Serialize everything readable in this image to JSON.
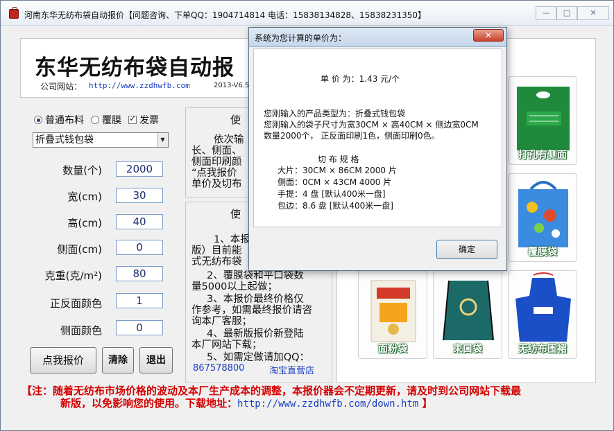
{
  "window": {
    "title": "河南东华无纺布袋自动报价【问题咨询、下单QQ：1904714814  电话：15838134828、15838231350】",
    "minimize": "—",
    "maximize": "□",
    "close": "✕"
  },
  "banner": {
    "title": "东华无纺布袋自动报",
    "site_label": "公司网站：",
    "site_url": "http://www.zzdhwfb.com",
    "version": "2013-V6.5"
  },
  "options": {
    "radio1": "普通布料",
    "radio2": "覆膜",
    "check": "发票",
    "radio1_selected": true,
    "check_checked": true
  },
  "product_select": {
    "value": "折叠式钱包袋"
  },
  "fields": [
    {
      "label": "数量(个)",
      "value": "2000"
    },
    {
      "label": "宽(cm)",
      "value": "30"
    },
    {
      "label": "高(cm)",
      "value": "40"
    },
    {
      "label": "侧面(cm)",
      "value": "0"
    },
    {
      "label": "克重(克/m²)",
      "value": "80"
    },
    {
      "label": "正反面颜色",
      "value": "1"
    },
    {
      "label": "侧面颜色",
      "value": "0"
    }
  ],
  "buttons": {
    "quote": "点我报价",
    "clear": "清除",
    "exit": "退出"
  },
  "panel1": {
    "heading": "使",
    "lines": [
      "依次输",
      "长、侧面、",
      "侧面印刷颜",
      "“点我报价",
      "单价及切布"
    ]
  },
  "panel2": {
    "heading": "使",
    "lines": [
      "1、本报",
      "版）目前能",
      "式无纺布袋",
      "2、覆膜袋和平口袋数",
      "量5000以上起做；",
      "3、本报价最终价格仅",
      "作参考，如需最终报价请咨",
      "询本厂客服；",
      "4、最新版报价新登陆",
      "本厂网站下载；",
      "5、如需定做请加QQ："
    ],
    "qq": "867578800",
    "shop": "淘宝直营店"
  },
  "gallery": {
    "captions": [
      "打孔有侧面",
      "覆膜袋",
      "面粉袋",
      "束口袋",
      "无纺布围裙"
    ]
  },
  "note": {
    "text1": "【注：随着无纺布市场价格的波动及本厂生产成本的调整，本报价器会不定期更新，请及时到公司网站下载最",
    "text2": "新版，以免影响您的使用。下载地址：",
    "url": "http://www.zzdhwfb.com/down.htm",
    "end": "】"
  },
  "dialog": {
    "title": "系统为您计算的单价为：",
    "close": "✕",
    "price": "单 价 为：1.43 元/个",
    "type_line": "您刚输入的产品类型为：折叠式钱包袋",
    "size_line": "您刚输入的袋子尺寸为宽30CM × 高40CM × 侧边宽0CM",
    "qty_line": "数量2000个，  正反面印刷1色，侧面印刷0色。",
    "spec_head": "切 布 规 格",
    "spec1": "大片：30CM × 86CM    2000 片",
    "spec2": "侧面：0CM × 43CM     4000 片",
    "spec3": "手提：4 盘   [默认400米一盘]",
    "spec4": "包边：8.6 盘      [默认400米一盘]",
    "ok": "确定"
  }
}
